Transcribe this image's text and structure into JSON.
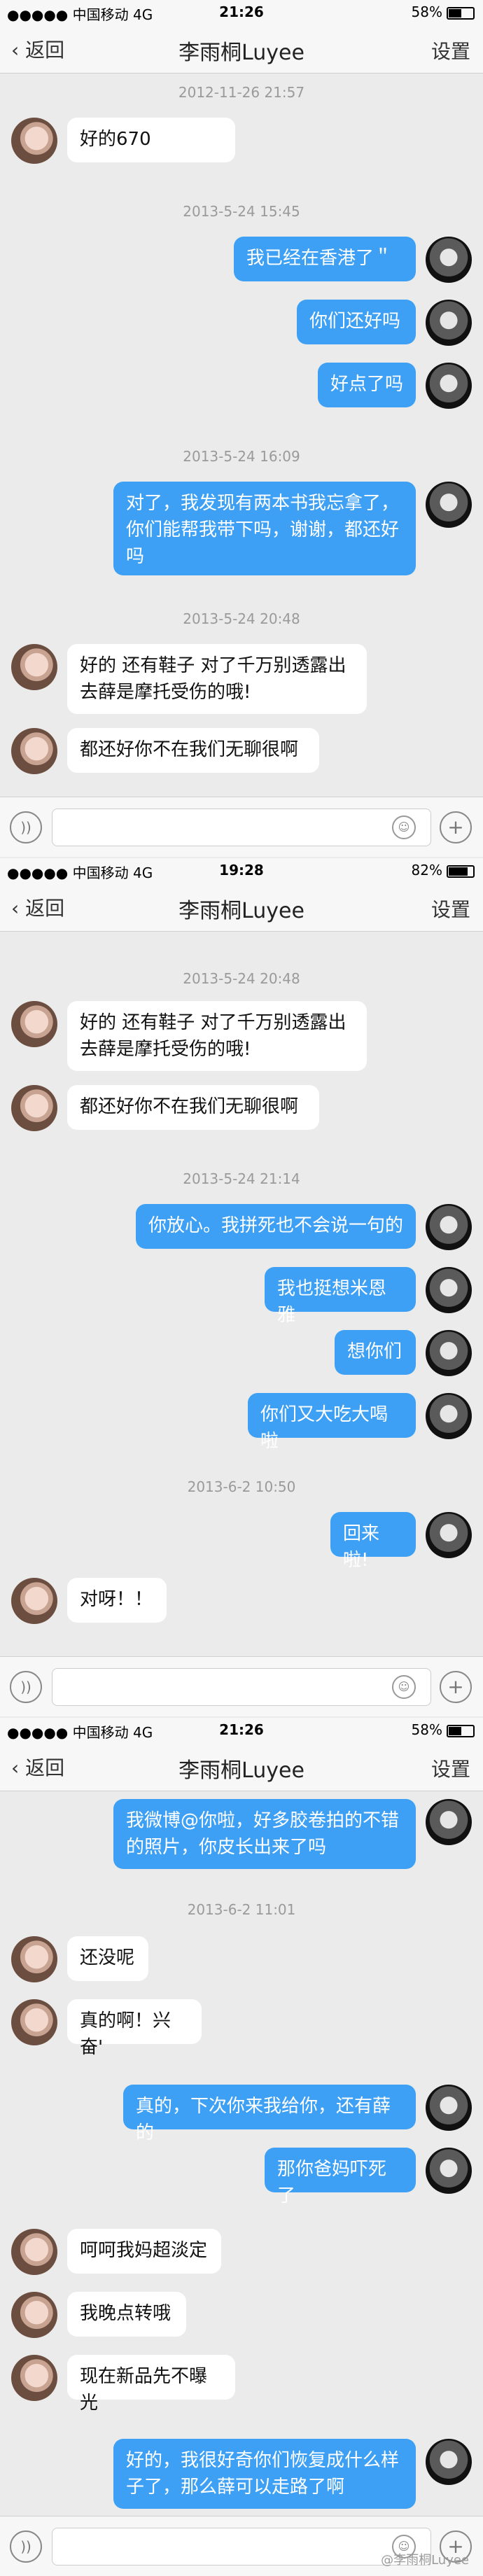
{
  "common": {
    "carrier": "●●●●● 中国移动",
    "network": "4G",
    "back": "返回",
    "title": "李雨桐Luyee",
    "settings": "设置"
  },
  "shots": [
    {
      "time": "21:26",
      "battery": "58%",
      "messages": [
        {
          "type": "ts",
          "text": "2012-11-26 21:57"
        },
        {
          "type": "in",
          "text": "好的670"
        },
        {
          "type": "ts",
          "text": "2013-5-24 15:45"
        },
        {
          "type": "out",
          "text": "我已经在香港了＂"
        },
        {
          "type": "out",
          "text": "你们还好吗"
        },
        {
          "type": "out",
          "text": "好点了吗"
        },
        {
          "type": "ts",
          "text": "2013-5-24 16:09"
        },
        {
          "type": "out",
          "text": "对了，我发现有两本书我忘拿了，你们能帮我带下吗，谢谢，都还好吗"
        },
        {
          "type": "ts",
          "text": "2013-5-24 20:48"
        },
        {
          "type": "in",
          "text": "好的 还有鞋子 对了千万别透露出去薛是摩托受伤的哦!"
        },
        {
          "type": "in",
          "text": "都还好你不在我们无聊很啊"
        }
      ]
    },
    {
      "time": "19:28",
      "battery": "82%",
      "messages": [
        {
          "type": "ts",
          "text": "2013-5-24 20:48"
        },
        {
          "type": "in",
          "text": "好的 还有鞋子 对了千万别透露出去薛是摩托受伤的哦!"
        },
        {
          "type": "in",
          "text": "都还好你不在我们无聊很啊"
        },
        {
          "type": "ts",
          "text": "2013-5-24 21:14"
        },
        {
          "type": "out",
          "text": "你放心。我拼死也不会说一句的"
        },
        {
          "type": "out",
          "text": "我也挺想米恩雅"
        },
        {
          "type": "out",
          "text": "想你们"
        },
        {
          "type": "out",
          "text": "你们又大吃大喝啦"
        },
        {
          "type": "ts",
          "text": "2013-6-2 10:50"
        },
        {
          "type": "out",
          "text": "回来啦!"
        },
        {
          "type": "in",
          "text": "对呀！！"
        }
      ]
    },
    {
      "time": "21:26",
      "battery": "58%",
      "messages": [
        {
          "type": "out",
          "text": "我微博@你啦，好多胶卷拍的不错的照片，你皮长出来了吗"
        },
        {
          "type": "ts",
          "text": "2013-6-2 11:01"
        },
        {
          "type": "in",
          "text": "还没呢"
        },
        {
          "type": "in",
          "text": "真的啊！兴奋'"
        },
        {
          "type": "out",
          "text": "真的，下次你来我给你，还有薛的"
        },
        {
          "type": "out",
          "text": "那你爸妈吓死了"
        },
        {
          "type": "in",
          "text": "呵呵我妈超淡定"
        },
        {
          "type": "in",
          "text": "我晚点转哦"
        },
        {
          "type": "in",
          "text": "现在新品先不曝光"
        },
        {
          "type": "out",
          "text": "好的，我很好奇你们恢复成什么样子了，那么薛可以走路了啊"
        }
      ]
    }
  ],
  "watermark": "@李雨桐Luyee"
}
